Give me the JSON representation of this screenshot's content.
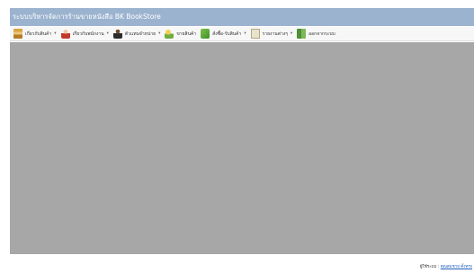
{
  "window": {
    "title": "ระบบบริหารจัดการร้านขายหนังสือ BK BookStore"
  },
  "menu": {
    "items": [
      {
        "label": "เกี่ยวกับสินค้า",
        "icon": "books-icon",
        "has_dropdown": true
      },
      {
        "label": "เกี่ยวกับพนักงาน",
        "icon": "woman-icon",
        "has_dropdown": true
      },
      {
        "label": "ตัวแทนจำหน่าย",
        "icon": "man-icon",
        "has_dropdown": true
      },
      {
        "label": "ขายสินค้า",
        "icon": "money-icon",
        "has_dropdown": false
      },
      {
        "label": "สั่งซื้อ-รับสินค้า",
        "icon": "order-icon",
        "has_dropdown": true
      },
      {
        "label": "รายงานต่างๆ",
        "icon": "report-icon",
        "has_dropdown": true
      },
      {
        "label": "ออกจากระบบ",
        "icon": "exit-icon",
        "has_dropdown": false
      }
    ],
    "caret": "▾"
  },
  "status": {
    "prefix": "ผู้ใช้ระบบ :",
    "user": "คุณสมชาย ตั้งทรง"
  },
  "colors": {
    "titlebar": "#9bb3cf",
    "content": "#a7a7a7",
    "link": "#1f5fbf"
  }
}
